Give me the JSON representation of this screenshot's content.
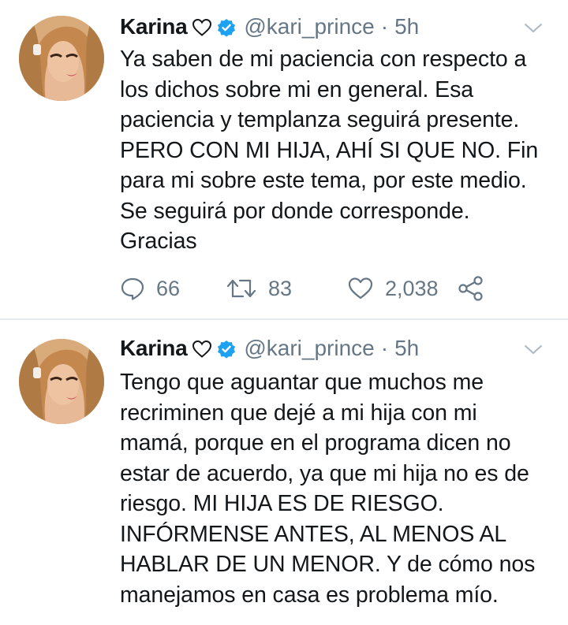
{
  "tweets": [
    {
      "name": "Karina",
      "handle": "@kari_prince",
      "separator": "·",
      "time": "5h",
      "text": "Ya saben de mi paciencia con respecto a\nlos dichos sobre mi en general. Esa\npaciencia y templanza seguirá presente.\nPERO CON MI HIJA, AHÍ SI QUE NO. Fin\npara mi sobre este tema, por este medio.\nSe seguirá por donde corresponde.\nGracias",
      "replies": "66",
      "retweets": "83",
      "likes": "2,038"
    },
    {
      "name": "Karina",
      "handle": "@kari_prince",
      "separator": "·",
      "time": "5h",
      "text": "Tengo que aguantar que muchos me\nrecriminen que dejé a mi hija con mi\nmamá, porque en el programa dicen no\nestar de acuerdo, ya que mi hija no es de\nriesgo. MI HIJA ES DE RIESGO.\nINFÓRMENSE ANTES,  AL MENOS AL\nHABLAR DE UN MENOR. Y de cómo nos\nmanejamos en casa es problema mío."
    }
  ],
  "icons": {
    "name_emoji": "white-heart-icon",
    "verified": "verified-badge-icon",
    "menu": "chevron-down-icon",
    "reply": "reply-icon",
    "retweet": "retweet-icon",
    "like": "heart-icon",
    "share": "share-icon"
  },
  "colors": {
    "text": "#14171a",
    "secondary": "#657786",
    "verified": "#1da1f2",
    "divider": "#e6ecf0"
  }
}
